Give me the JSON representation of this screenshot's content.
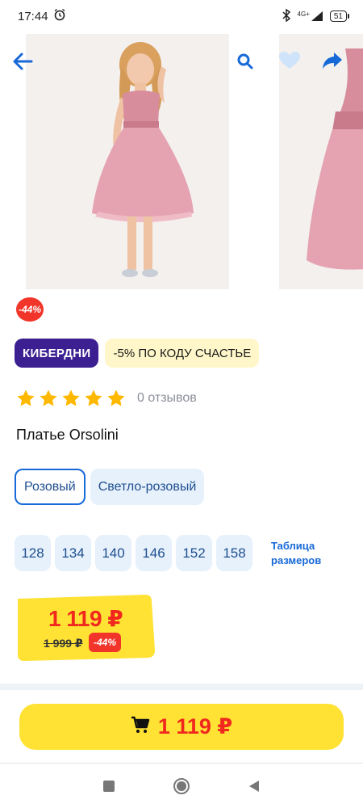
{
  "status_bar": {
    "time": "17:44",
    "network": "4G+",
    "battery": "51",
    "icons": [
      "alarm-icon",
      "bluetooth-icon",
      "signal-icon",
      "battery-icon"
    ]
  },
  "header": {
    "icons": [
      "back-arrow-icon",
      "search-icon",
      "heart-icon",
      "share-icon"
    ]
  },
  "gallery": {
    "images": [
      "girl-in-pink-dress-photo",
      "pink-dress-closeup-photo"
    ]
  },
  "product": {
    "discount_badge": "-44%",
    "promo_brand": "КИБЕРДНИ",
    "promo_code": "-5% ПО КОДУ СЧАСТЬЕ",
    "rating": 5,
    "reviews": "0 отзывов",
    "title": "Платье Orsolini"
  },
  "colors": {
    "selected": "Розовый",
    "options": [
      "Розовый",
      "Светло-розовый"
    ]
  },
  "sizes": {
    "options": [
      "128",
      "134",
      "140",
      "146",
      "152",
      "158"
    ],
    "table_link": "Таблица размеров"
  },
  "price": {
    "current": "1 119 ₽",
    "old": "1 999 ₽",
    "discount": "-44%"
  },
  "buy_button": {
    "label": "1 119 ₽",
    "icon": "cart-icon"
  },
  "nav": {
    "buttons": [
      "recents-square-icon",
      "home-circle-icon",
      "back-triangle-icon"
    ]
  },
  "colors_palette": {
    "accent_blue": "#1769d8",
    "promo_purple": "#3c1f91",
    "price_red": "#f0281e",
    "button_yellow": "#ffe234",
    "chip_bg": "#e6f1fc"
  }
}
